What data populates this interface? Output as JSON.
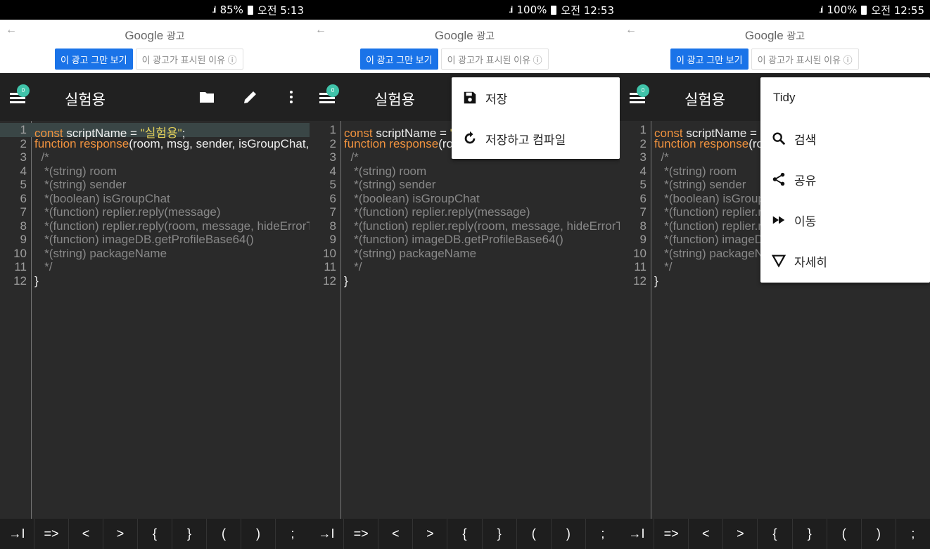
{
  "colors": {
    "ad_primary": "#1a73e8",
    "toolbar_bg": "#212121",
    "editor_bg": "#2a2a2a",
    "keyword": "#f0923e",
    "string": "#e2cf5a",
    "comment": "#888888",
    "badge": "#40c4aa"
  },
  "ad": {
    "back_glyph": "←",
    "google": "Google",
    "label": "광고",
    "stop_button": "이 광고 그만 보기",
    "why_button": "이 광고가 표시된 이유 ⓘ"
  },
  "screens": [
    {
      "status": {
        "signal": ".ıl",
        "battery": "85%",
        "time": "오전 5:13"
      },
      "toolbar": {
        "badge": "0",
        "title": "실험용",
        "icons": [
          "folder-icon",
          "pencil-icon",
          "more-vert-icon"
        ]
      }
    },
    {
      "status": {
        "signal": ".ıl",
        "battery": "100%",
        "time": "오전 12:53"
      },
      "toolbar": {
        "badge": "0",
        "title": "실험용"
      },
      "menu": [
        {
          "icon": "save-icon",
          "label": "저장"
        },
        {
          "icon": "refresh-icon",
          "label": "저장하고 컴파일"
        }
      ]
    },
    {
      "status": {
        "signal": ".ıl",
        "battery": "100%",
        "time": "오전 12:55"
      },
      "toolbar": {
        "badge": "0",
        "title": "실험용"
      },
      "menu": [
        {
          "icon": "",
          "label": "Tidy"
        },
        {
          "icon": "search-icon",
          "label": "검색"
        },
        {
          "icon": "share-icon",
          "label": "공유"
        },
        {
          "icon": "fast-forward-icon",
          "label": "이동"
        },
        {
          "icon": "filter-icon",
          "label": "자세히"
        }
      ]
    }
  ],
  "code": {
    "line_numbers": [
      "1",
      "2",
      "3",
      "4",
      "5",
      "6",
      "7",
      "8",
      "9",
      "10",
      "11",
      "12"
    ],
    "lines": [
      [
        [
          "kw",
          "const"
        ],
        [
          "tx",
          " scriptName = "
        ],
        [
          "str",
          "\"실험용\""
        ],
        [
          "tx",
          ";"
        ]
      ],
      [
        [
          "kw",
          "function"
        ],
        [
          "tx",
          " "
        ],
        [
          "fn",
          "response"
        ],
        [
          "tx",
          "(room, msg, sender, isGroupChat, replier, imageDB, packageName)"
        ]
      ],
      [
        [
          "cm",
          "  /*"
        ]
      ],
      [
        [
          "cm",
          "   *(string) room"
        ]
      ],
      [
        [
          "cm",
          "   *(string) sender"
        ]
      ],
      [
        [
          "cm",
          "   *(boolean) isGroupChat"
        ]
      ],
      [
        [
          "cm",
          "   *(function) replier.reply(message)"
        ]
      ],
      [
        [
          "cm",
          "   *(function) replier.reply(room, message, hideErrorToast = false)"
        ]
      ],
      [
        [
          "cm",
          "   *(function) imageDB.getProfileBase64()"
        ]
      ],
      [
        [
          "cm",
          "   *(string) packageName"
        ]
      ],
      [
        [
          "cm",
          "   */"
        ]
      ],
      [
        [
          "tx",
          "}"
        ]
      ]
    ]
  },
  "keys": [
    "→I",
    "=>",
    "<",
    ">",
    "{",
    "}",
    "(",
    ")",
    ";"
  ]
}
